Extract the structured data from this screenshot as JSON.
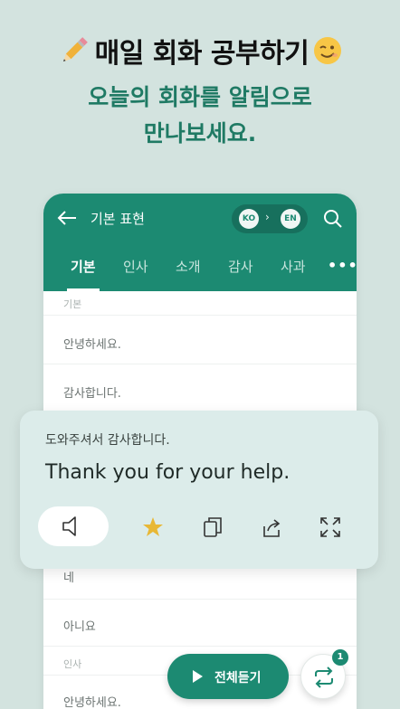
{
  "promo": {
    "headline": "매일 회화 공부하기",
    "subline_1": "오늘의 회화를 알림으로",
    "subline_2": "만나보세요."
  },
  "appbar": {
    "title": "기본 표현",
    "lang_from": "KO",
    "lang_to": "EN",
    "background_color": "#1c8a72"
  },
  "tabs": [
    {
      "label": "기본",
      "active": true
    },
    {
      "label": "인사",
      "active": false
    },
    {
      "label": "소개",
      "active": false
    },
    {
      "label": "감사",
      "active": false
    },
    {
      "label": "사과",
      "active": false
    }
  ],
  "tabs_more": "•••",
  "list": {
    "section_basic": "기본",
    "items_top": [
      "안녕하세요.",
      "감사합니다."
    ],
    "items_bottom": [
      "네",
      "아니요"
    ],
    "section_greeting": "인사",
    "items_greeting": [
      "안녕하세요."
    ]
  },
  "card": {
    "korean": "도와주셔서 감사합니다.",
    "english": "Thank you for your help.",
    "actions": [
      "speaker-icon",
      "star-icon",
      "copy-icon",
      "share-icon",
      "expand-icon"
    ],
    "star_color": "#e8b836"
  },
  "play_all": {
    "label": "전체듣기"
  },
  "repeat": {
    "badge": "1"
  }
}
